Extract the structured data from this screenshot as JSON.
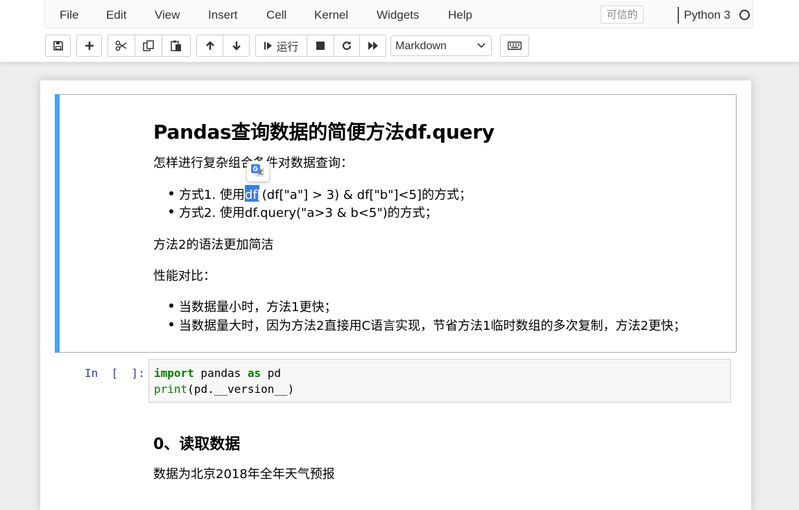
{
  "menu": {
    "items": [
      "File",
      "Edit",
      "View",
      "Insert",
      "Cell",
      "Kernel",
      "Widgets",
      "Help"
    ],
    "trusted_label": "可信的",
    "kernel_name": "Python 3"
  },
  "toolbar": {
    "buttons": [
      "save-icon",
      "plus-icon",
      "scissors-icon",
      "copy-icon",
      "paste-icon",
      "arrow-up-icon",
      "arrow-down-icon",
      "step-forward-icon",
      "stop-icon",
      "restart-icon",
      "fast-forward-icon",
      "keyboard-icon"
    ],
    "run_label": "运行",
    "cell_type": "Markdown"
  },
  "markdown_cell": {
    "title": "Pandas查询数据的简便方法df.query",
    "intro": "怎样进行复杂组合条件对数据查询：",
    "method1_prefix": "方式1. 使用",
    "method1_selected": "df[",
    "method1_suffix": "(df[\"a\"] > 3) & df[\"b\"]<5]的方式；",
    "method2": "方式2. 使用df.query(\"a>3 & b<5\")的方式；",
    "note": "方法2的语法更加简洁",
    "perf_heading": "性能对比：",
    "perf_items": [
      "当数据量小时，方法1更快；",
      "当数据量大时，因为方法2直接用C语言实现，节省方法1临时数组的多次复制，方法2更快；"
    ]
  },
  "code_cell": {
    "prompt": "In  [  ]:",
    "line1": {
      "kw1": "import",
      "mod": " pandas ",
      "kw2": "as",
      "alias": " pd"
    },
    "line2": {
      "fn": "print",
      "rest": "(pd.__version__)"
    }
  },
  "section0": {
    "heading": "0、读取数据",
    "desc": "数据为北京2018年全年天气预报"
  },
  "colors": {
    "cell_bar": "#42a5f5",
    "selection": "#3b7ddd",
    "keyword": "#008000",
    "prompt": "#303f9f"
  }
}
